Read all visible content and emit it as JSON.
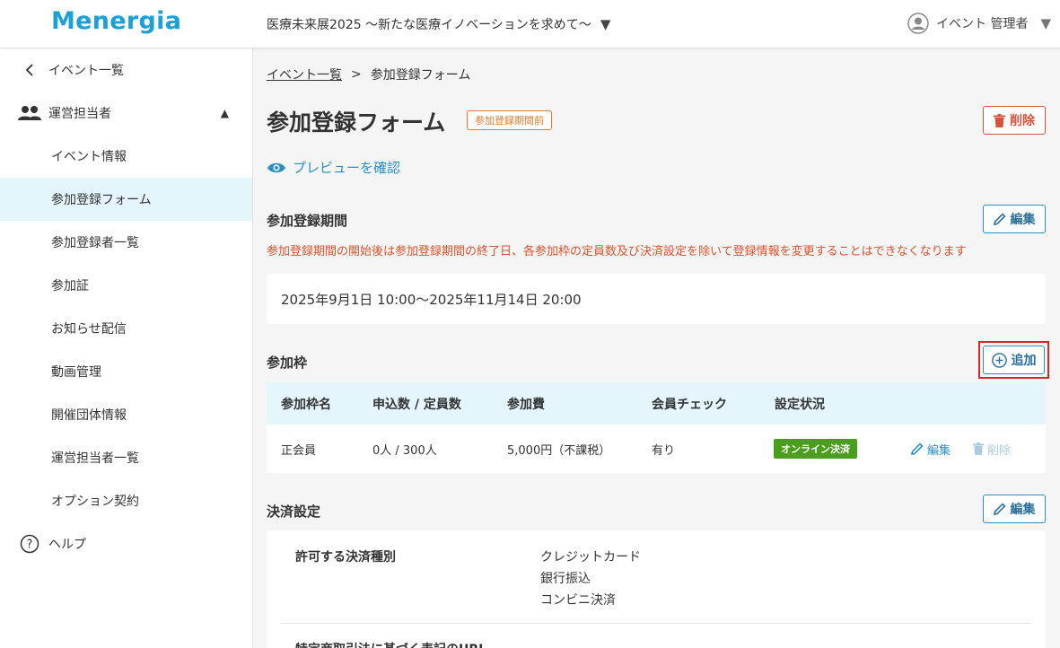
{
  "app": {
    "logo": "Menergia"
  },
  "header": {
    "event_name": "医療未来展2025 〜新たな医療イノベーションを求めて〜",
    "user_name": "イベント 管理者"
  },
  "sidebar": {
    "back_label": "イベント一覧",
    "group_label": "運営担当者",
    "items": [
      {
        "label": "イベント情報"
      },
      {
        "label": "参加登録フォーム"
      },
      {
        "label": "参加登録者一覧"
      },
      {
        "label": "参加証"
      },
      {
        "label": "お知らせ配信"
      },
      {
        "label": "動画管理"
      },
      {
        "label": "開催団体情報"
      },
      {
        "label": "運営担当者一覧"
      },
      {
        "label": "オプション契約"
      }
    ],
    "help_label": "ヘルプ"
  },
  "breadcrumb": {
    "parent": "イベント一覧",
    "separator": ">",
    "current": "参加登録フォーム"
  },
  "page": {
    "title": "参加登録フォーム",
    "status_badge": "参加登録期間前",
    "delete_label": "削除",
    "preview_label": "プレビューを確認"
  },
  "registration_period": {
    "title": "参加登録期間",
    "edit_label": "編集",
    "warning": "参加登録期間の開始後は参加登録期間の終了日、各参加枠の定員数及び決済設定を除いて登録情報を変更することはできなくなります",
    "value": "2025年9月1日 10:00〜2025年11月14日 20:00"
  },
  "slots": {
    "title": "参加枠",
    "add_label": "追加",
    "columns": [
      "参加枠名",
      "申込数 / 定員数",
      "参加費",
      "会員チェック",
      "設定状況"
    ],
    "rows": [
      {
        "name": "正会員",
        "count": "0人 / 300人",
        "fee": "5,000円（不課税）",
        "member_check": "有り",
        "status": "オンライン決済",
        "edit_label": "編集",
        "delete_label": "削除"
      }
    ]
  },
  "payment": {
    "title": "決済設定",
    "edit_label": "編集",
    "allowed_label": "許可する決済種別",
    "methods": [
      "クレジットカード",
      "銀行振込",
      "コンビニ決済"
    ],
    "next_label": "特定商取引法に基づく表記のURL"
  },
  "colors": {
    "brand": "#1ba0d8",
    "accent": "#2a8fc3",
    "danger": "#d9533a",
    "warning": "#e07b2f",
    "success": "#4a9e1d",
    "active_bg": "#e4f5fc"
  }
}
